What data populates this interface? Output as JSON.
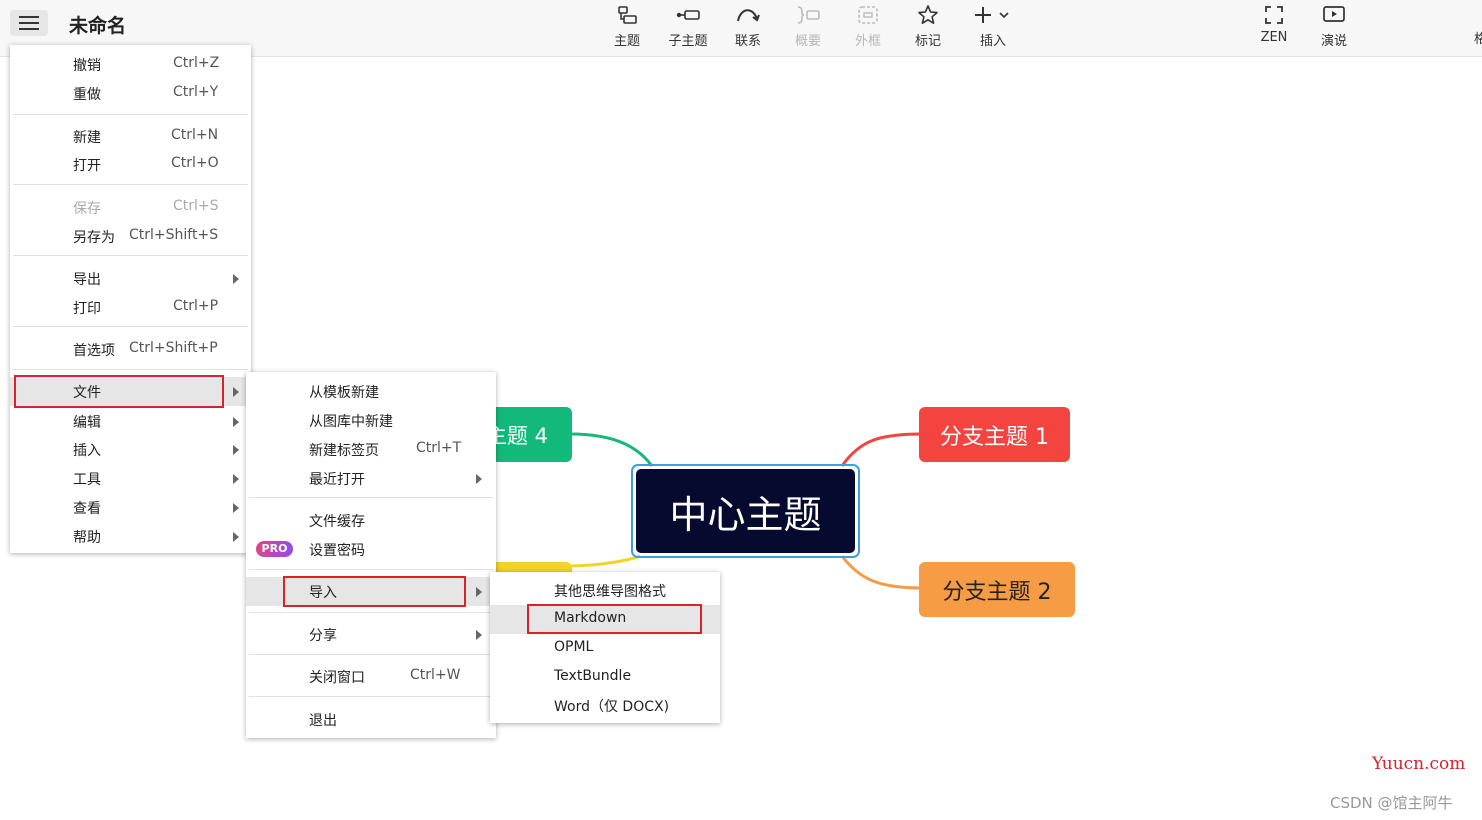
{
  "app": {
    "doc_title": "未命名"
  },
  "toolbar": [
    {
      "id": "topic",
      "label": "主题",
      "icon": "topic-icon"
    },
    {
      "id": "subtopic",
      "label": "子主题",
      "icon": "subtopic-icon"
    },
    {
      "id": "relationship",
      "label": "联系",
      "icon": "relationship-icon"
    },
    {
      "id": "summary",
      "label": "概要",
      "icon": "summary-icon",
      "disabled": true
    },
    {
      "id": "boundary",
      "label": "外框",
      "icon": "boundary-icon",
      "disabled": true
    },
    {
      "id": "marker",
      "label": "标记",
      "icon": "star-icon"
    },
    {
      "id": "insert",
      "label": "插入",
      "icon": "plus-icon"
    },
    {
      "id": "zen",
      "label": "ZEN",
      "icon": "fullscreen-icon"
    },
    {
      "id": "pitch",
      "label": "演说",
      "icon": "play-icon"
    }
  ],
  "toolbar_edge_char": "格",
  "main_menu": {
    "items": [
      {
        "label": "撤销",
        "shortcut": "Ctrl+Z"
      },
      {
        "label": "重做",
        "shortcut": "Ctrl+Y"
      },
      {
        "label": "新建",
        "shortcut": "Ctrl+N"
      },
      {
        "label": "打开",
        "shortcut": "Ctrl+O"
      },
      {
        "label": "保存",
        "shortcut": "Ctrl+S",
        "disabled": true
      },
      {
        "label": "另存为",
        "shortcut": "Ctrl+Shift+S"
      },
      {
        "label": "导出",
        "submenu": true
      },
      {
        "label": "打印",
        "shortcut": "Ctrl+P"
      },
      {
        "label": "首选项",
        "shortcut": "Ctrl+Shift+P"
      },
      {
        "label": "文件",
        "submenu": true,
        "highlighted": true
      },
      {
        "label": "编辑",
        "submenu": true
      },
      {
        "label": "插入",
        "submenu": true
      },
      {
        "label": "工具",
        "submenu": true
      },
      {
        "label": "查看",
        "submenu": true
      },
      {
        "label": "帮助",
        "submenu": true
      }
    ]
  },
  "file_menu": {
    "items": [
      {
        "label": "从模板新建"
      },
      {
        "label": "从图库中新建"
      },
      {
        "label": "新建标签页",
        "shortcut": "Ctrl+T"
      },
      {
        "label": "最近打开",
        "submenu": true
      },
      {
        "label": "文件缓存"
      },
      {
        "label": "设置密码",
        "badge": "PRO"
      },
      {
        "label": "导入",
        "submenu": true,
        "highlighted": true
      },
      {
        "label": "分享",
        "submenu": true
      },
      {
        "label": "关闭窗口",
        "shortcut": "Ctrl+W"
      },
      {
        "label": "退出"
      }
    ]
  },
  "import_menu": {
    "items": [
      {
        "label": "其他思维导图格式"
      },
      {
        "label": "Markdown",
        "highlighted": true
      },
      {
        "label": "OPML"
      },
      {
        "label": "TextBundle"
      },
      {
        "label": "Word（仅 DOCX)"
      }
    ]
  },
  "mindmap": {
    "center": {
      "label": "中心主题",
      "color": "#050a2e"
    },
    "branches": [
      {
        "label": "分支主题 1",
        "color": "#f4443f"
      },
      {
        "label": "分支主题 2",
        "color": "#f59c45"
      },
      {
        "label": "主题 4",
        "color": "#13b97a"
      },
      {
        "label": "",
        "color": "#f3d32a"
      }
    ]
  },
  "watermarks": {
    "site": "Yuucn.com",
    "author": "CSDN @馆主阿牛"
  }
}
